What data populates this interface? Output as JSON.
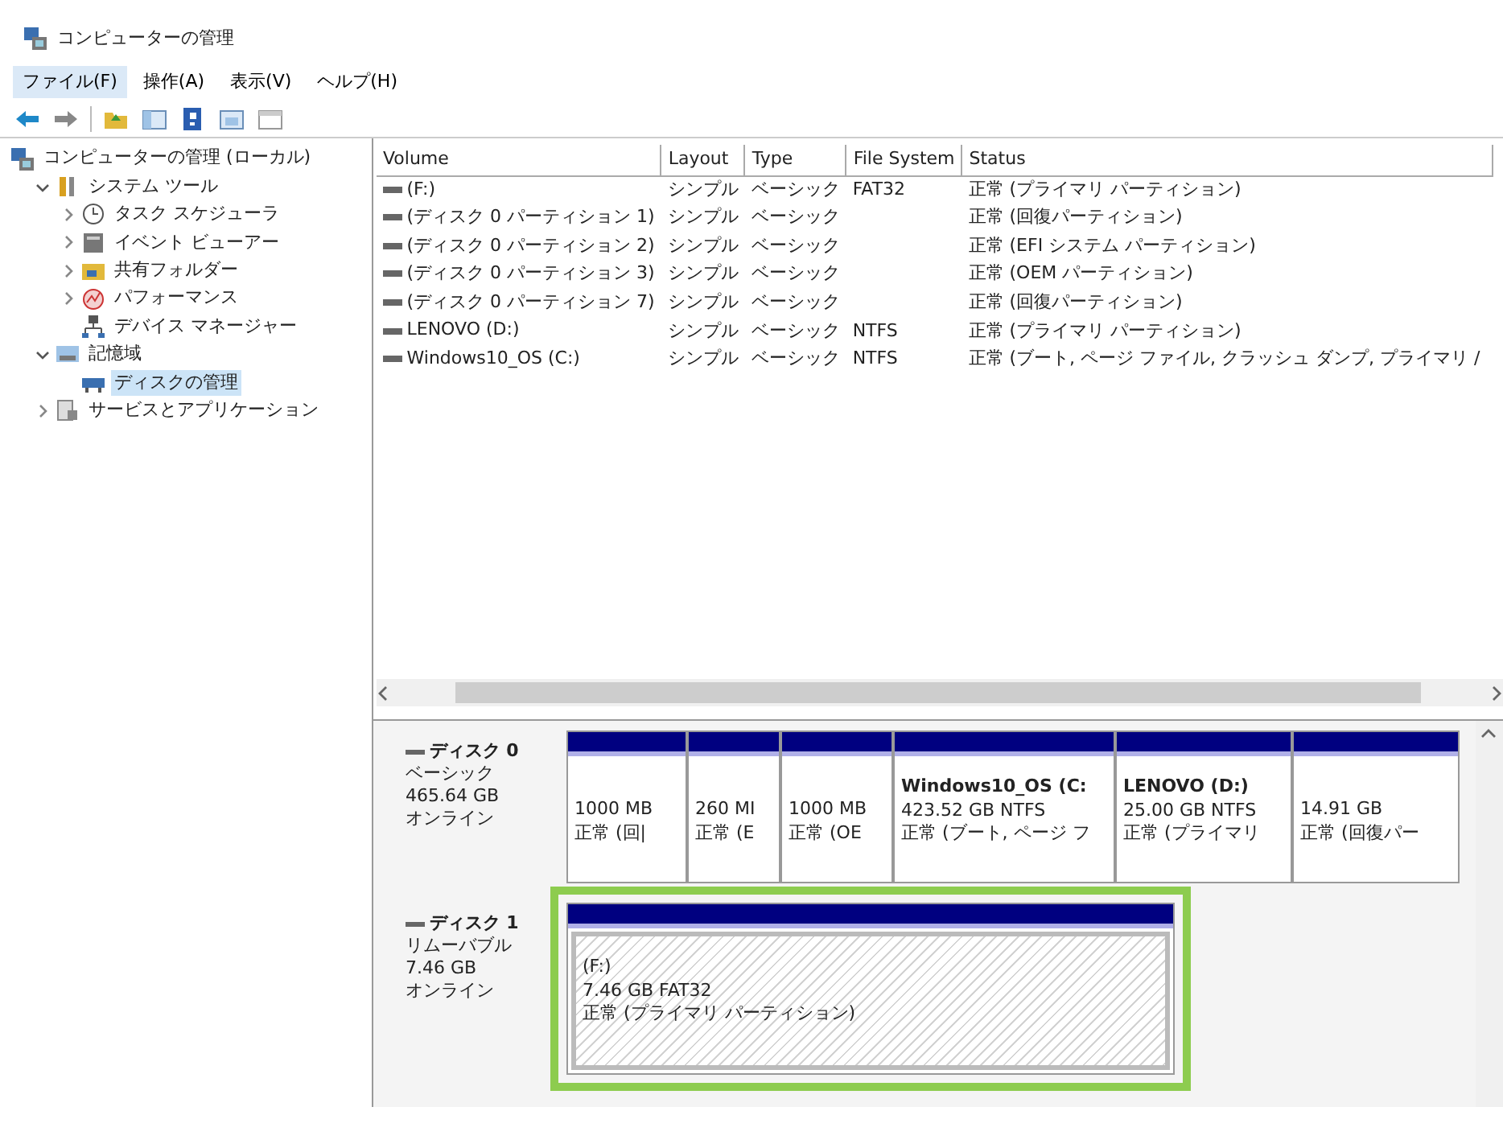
{
  "window": {
    "title": "コンピューターの管理"
  },
  "menu": [
    {
      "label": "ファイル(F)",
      "selected": true
    },
    {
      "label": "操作(A)",
      "selected": false
    },
    {
      "label": "表示(V)",
      "selected": false
    },
    {
      "label": "ヘルプ(H)",
      "selected": false
    }
  ],
  "tree": [
    {
      "label": "コンピューターの管理 (ローカル)",
      "selected": false,
      "children": [
        {
          "label": "システム ツール",
          "expanded": true,
          "selected": false,
          "children": [
            {
              "label": "タスク スケジューラ",
              "expanded": false,
              "selected": false
            },
            {
              "label": "イベント ビューアー",
              "expanded": false,
              "selected": false
            },
            {
              "label": "共有フォルダー",
              "expanded": false,
              "selected": false
            },
            {
              "label": "パフォーマンス",
              "expanded": false,
              "selected": false
            },
            {
              "label": "デバイス マネージャー",
              "selected": false
            }
          ]
        },
        {
          "label": "記憶域",
          "expanded": true,
          "selected": false,
          "children": [
            {
              "label": "ディスクの管理",
              "selected": true
            }
          ]
        },
        {
          "label": "サービスとアプリケーション",
          "expanded": false,
          "selected": false
        }
      ]
    }
  ],
  "table": {
    "columns": [
      "Volume",
      "Layout",
      "Type",
      "File System",
      "Status"
    ],
    "rows": [
      [
        "(F:)",
        "シンプル",
        "ベーシック",
        "FAT32",
        "正常 (プライマリ パーティション)"
      ],
      [
        "(ディスク 0 パーティション 1)",
        "シンプル",
        "ベーシック",
        "",
        "正常 (回復パーティション)"
      ],
      [
        "(ディスク 0 パーティション 2)",
        "シンプル",
        "ベーシック",
        "",
        "正常 (EFI システム パーティション)"
      ],
      [
        "(ディスク 0 パーティション 3)",
        "シンプル",
        "ベーシック",
        "",
        "正常 (OEM パーティション)"
      ],
      [
        "(ディスク 0 パーティション 7)",
        "シンプル",
        "ベーシック",
        "",
        "正常 (回復パーティション)"
      ],
      [
        "LENOVO (D:)",
        "シンプル",
        "ベーシック",
        "NTFS",
        "正常 (プライマリ パーティション)"
      ],
      [
        "Windows10_OS (C:)",
        "シンプル",
        "ベーシック",
        "NTFS",
        "正常 (ブート, ページ ファイル, クラッシュ ダンプ, プライマリ /"
      ]
    ]
  },
  "disks": [
    {
      "name": "ディスク 0",
      "type": "ベーシック",
      "size": "465.64 GB",
      "state": "オンライン",
      "partitions": [
        {
          "lines": [
            "1000 MB",
            "正常 (回|"
          ],
          "selected": false,
          "highlighted": false
        },
        {
          "lines": [
            "260 MI",
            "正常 (E"
          ],
          "selected": false,
          "highlighted": false
        },
        {
          "lines": [
            "1000 MB",
            "正常 (OE"
          ],
          "selected": false,
          "highlighted": false
        },
        {
          "title": "Windows10_OS  (C:",
          "lines": [
            "423.52 GB NTFS",
            "正常 (ブート, ページ フ"
          ],
          "selected": false,
          "highlighted": false
        },
        {
          "title": "LENOVO  (D:)",
          "lines": [
            "25.00 GB NTFS",
            "正常 (プライマリ"
          ],
          "selected": false,
          "highlighted": false
        },
        {
          "lines": [
            "14.91 GB",
            "正常 (回復パー"
          ],
          "selected": false,
          "highlighted": false
        }
      ]
    },
    {
      "name": "ディスク 1",
      "type": "リムーバブル",
      "size": "7.46 GB",
      "state": "オンライン",
      "partitions": [
        {
          "lines": [
            "(F:)",
            "7.46 GB FAT32",
            "正常 (プライマリ パーティション)"
          ],
          "selected": true,
          "highlighted": true
        }
      ]
    }
  ]
}
